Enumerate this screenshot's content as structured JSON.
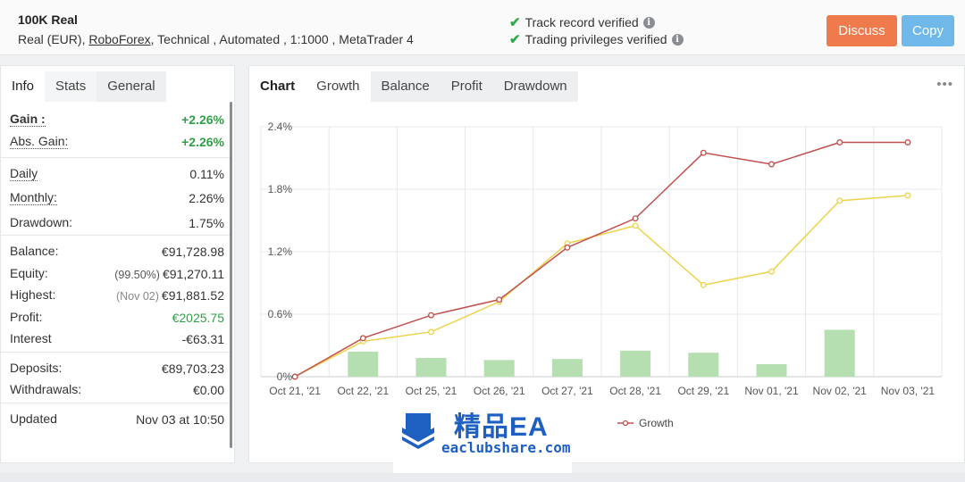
{
  "header": {
    "account_name": "100K Real",
    "account_sub_prefix": "Real (EUR),",
    "broker_link": "RoboForex",
    "account_sub_suffix": ", Technical , Automated , 1:1000 , MetaTrader 4",
    "verified_1": "Track record verified",
    "verified_2": "Trading privileges verified",
    "info_glyph": "i",
    "discuss_label": "Discuss",
    "copy_label": "Copy"
  },
  "stats_tabs": [
    "Info",
    "Stats",
    "General"
  ],
  "stats": {
    "gain_label": "Gain :",
    "gain_value": "+2.26%",
    "abs_gain_label": "Abs. Gain:",
    "abs_gain_value": "+2.26%",
    "daily_label": "Daily",
    "daily_value": "0.11%",
    "monthly_label": "Monthly:",
    "monthly_value": "2.26%",
    "drawdown_label": "Drawdown:",
    "drawdown_value": "1.75%",
    "balance_label": "Balance:",
    "balance_value": "€91,728.98",
    "equity_label": "Equity:",
    "equity_note": "(99.50%)",
    "equity_value": "€91,270.11",
    "highest_label": "Highest:",
    "highest_note": "(Nov 02)",
    "highest_value": "€91,881.52",
    "profit_label": "Profit:",
    "profit_value": "€2025.75",
    "interest_label": "Interest",
    "interest_value": "-€63.31",
    "deposits_label": "Deposits:",
    "deposits_value": "€89,703.23",
    "withdrawals_label": "Withdrawals:",
    "withdrawals_value": "€0.00",
    "updated_label": "Updated",
    "updated_value": "Nov 03 at 10:50"
  },
  "chart_tabs": {
    "heading": "Chart",
    "items": [
      "Growth",
      "Balance",
      "Profit",
      "Drawdown"
    ],
    "more_glyph": "•••"
  },
  "chart_data": {
    "type": "line",
    "categories": [
      "Oct 21, '21",
      "Oct 22, '21",
      "Oct 25, '21",
      "Oct 26, '21",
      "Oct 27, '21",
      "Oct 28, '21",
      "Oct 29, '21",
      "Nov 01, '21",
      "Nov 02, '21",
      "Nov 03, '21"
    ],
    "visible_tick_labels": [
      "Oct 21, '21",
      "Oct 22, '21",
      "Oct 25, '21",
      "Oct 26, '21",
      "Oct 27, '21",
      "Oct 28, '21",
      "Oct 29, '21",
      "Nov 01, '21",
      "Nov 02, '21",
      "Nov 03, '21"
    ],
    "y_ticks": [
      "0%",
      "0.6%",
      "1.2%",
      "1.8%",
      "2.4%"
    ],
    "ylim": [
      0,
      2.4
    ],
    "grid": true,
    "legend_position": "bottom",
    "series": [
      {
        "name": "Growth",
        "color": "#c0504d",
        "values": [
          0,
          0.37,
          0.59,
          0.74,
          1.24,
          1.52,
          2.15,
          2.04,
          2.25,
          2.25
        ]
      },
      {
        "color": "#ecd34a",
        "values": [
          0,
          0.34,
          0.43,
          0.72,
          1.28,
          1.45,
          0.88,
          1.01,
          1.69,
          1.74
        ]
      }
    ],
    "bars": {
      "color": "#b6dfb1",
      "values": [
        null,
        0.24,
        0.18,
        0.16,
        0.17,
        0.25,
        0.23,
        0.12,
        0.45,
        null
      ]
    }
  },
  "watermark": {
    "title": "精品EA",
    "url": "eaclubshare.com"
  }
}
